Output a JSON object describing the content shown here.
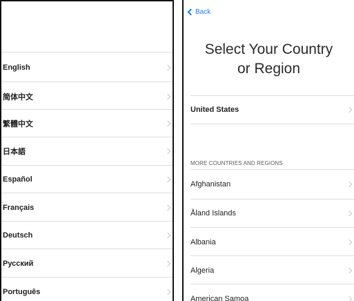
{
  "language_screen": {
    "languages": [
      "English",
      "简体中文",
      "繁體中文",
      "日本語",
      "Español",
      "Français",
      "Deutsch",
      "Русский",
      "Português"
    ]
  },
  "region_screen": {
    "back_label": "Back",
    "title_line1": "Select Your Country",
    "title_line2": "or Region",
    "suggested": "United States",
    "section_header": "MORE COUNTRIES AND REGIONS",
    "countries": [
      "Afghanistan",
      "Åland Islands",
      "Albania",
      "Algeria",
      "American Samoa"
    ]
  },
  "colors": {
    "accent": "#147efb",
    "separator": "#dcdcdc",
    "chevron": "#c7c7cc"
  },
  "icons": {
    "row_chevron": "chevron-right-icon",
    "back": "chevron-left-icon"
  }
}
